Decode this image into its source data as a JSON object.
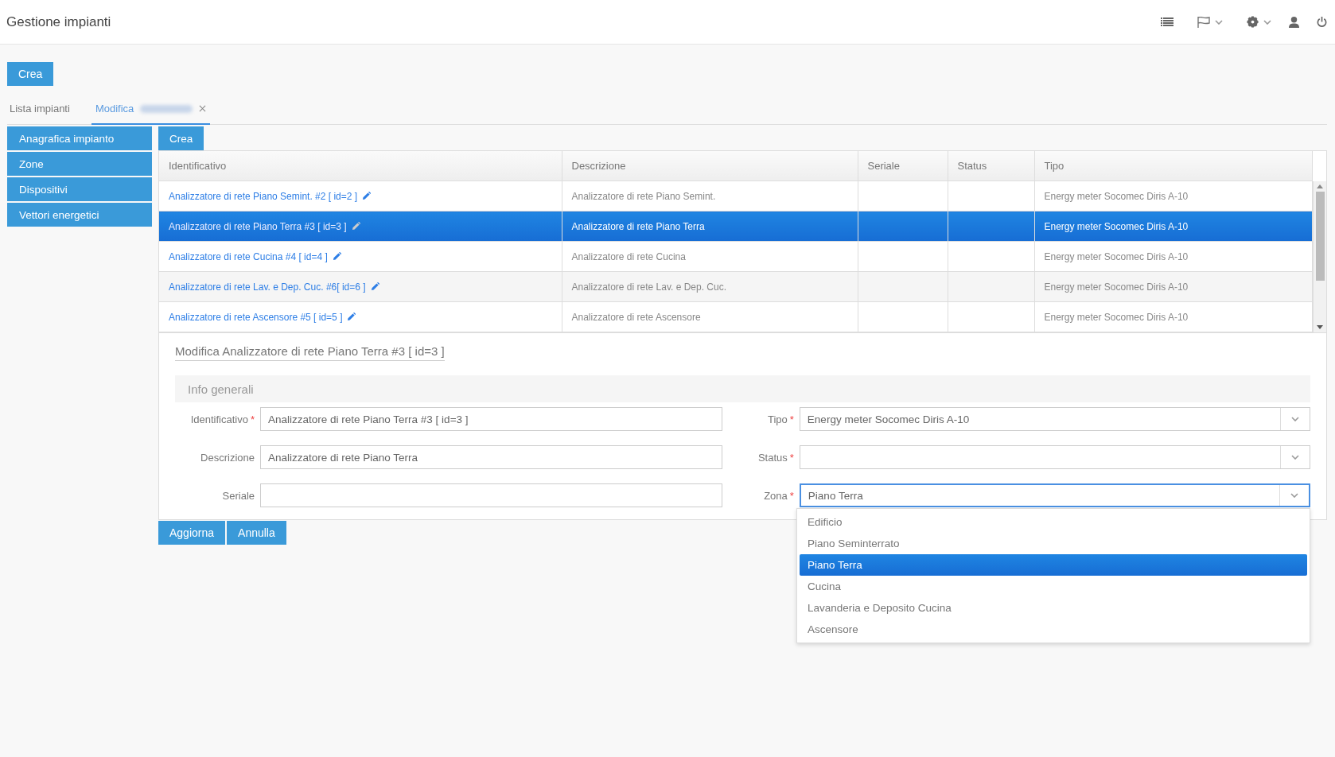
{
  "header": {
    "title": "Gestione impianti"
  },
  "create_button": "Crea",
  "tabs": [
    {
      "label": "Lista impianti",
      "selected": false,
      "closable": false,
      "redacted": false
    },
    {
      "label": "Modifica",
      "selected": true,
      "closable": true,
      "redacted": true
    }
  ],
  "sidebar": {
    "items": [
      {
        "label": "Anagrafica impianto"
      },
      {
        "label": "Zone"
      },
      {
        "label": "Dispositivi"
      },
      {
        "label": "Vettori energetici"
      }
    ]
  },
  "table": {
    "create_button": "Crea",
    "columns": [
      "Identificativo",
      "Descrizione",
      "Seriale",
      "Status",
      "Tipo"
    ],
    "rows": [
      {
        "selected": false,
        "identificativo": "Analizzatore di rete Piano Semint. #2 [ id=2 ]",
        "descrizione": "Analizzatore di rete Piano Semint.",
        "tipo": "Energy meter Socomec Diris A-10"
      },
      {
        "selected": true,
        "identificativo": "Analizzatore di rete Piano Terra #3 [ id=3 ]",
        "descrizione": "Analizzatore di rete Piano Terra",
        "tipo": "Energy meter Socomec Diris A-10"
      },
      {
        "selected": false,
        "identificativo": "Analizzatore di rete Cucina #4 [ id=4 ]",
        "descrizione": "Analizzatore di rete Cucina",
        "tipo": "Energy meter Socomec Diris A-10"
      },
      {
        "selected": false,
        "identificativo": "Analizzatore di rete Lav. e Dep. Cuc. #6[ id=6 ]",
        "descrizione": "Analizzatore di rete Lav. e Dep. Cuc.",
        "tipo": "Energy meter Socomec Diris A-10"
      },
      {
        "selected": false,
        "identificativo": "Analizzatore di rete Ascensore #5 [ id=5 ]",
        "descrizione": "Analizzatore di rete Ascensore",
        "tipo": "Energy meter Socomec Diris A-10"
      }
    ]
  },
  "form": {
    "title": "Modifica Analizzatore di rete Piano Terra #3 [ id=3 ]",
    "section": "Info generali",
    "left_fields": [
      {
        "label": "Identificativo",
        "required_mark": "*",
        "value": "Analizzatore di rete Piano Terra #3 [ id=3 ]"
      },
      {
        "label": "Descrizione",
        "value": "Analizzatore di rete Piano Terra"
      },
      {
        "label": "Seriale"
      }
    ],
    "right_fields": [
      {
        "label": "Tipo",
        "required_mark": "*",
        "focused": false,
        "value": "Energy meter Socomec Diris A-10"
      },
      {
        "label": "Status",
        "required_mark": "*",
        "focused": false
      },
      {
        "label": "Zona",
        "required_mark": "*",
        "focused": true,
        "value": "Piano Terra"
      }
    ],
    "dropdown": {
      "options": [
        {
          "label": "Edificio",
          "selected": false
        },
        {
          "label": "Piano Seminterrato",
          "selected": false
        },
        {
          "label": "Piano Terra",
          "selected": true
        },
        {
          "label": "Cucina",
          "selected": false
        },
        {
          "label": "Lavanderia e Deposito Cucina",
          "selected": false
        },
        {
          "label": "Ascensore",
          "selected": false
        }
      ]
    }
  },
  "actions": [
    "Aggiorna",
    "Annulla"
  ]
}
